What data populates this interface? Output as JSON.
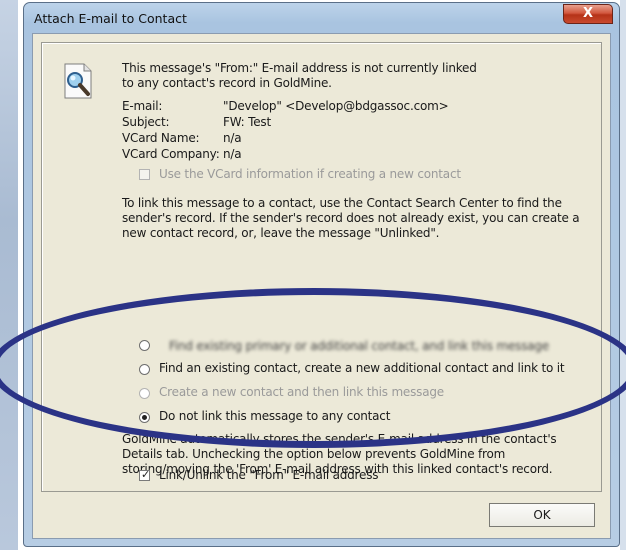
{
  "window": {
    "title": "Attach E-mail to Contact",
    "close_label": "X"
  },
  "message": "This message's \"From:\" E-mail address is not currently linked to any contact's record in GoldMine.",
  "fields": [
    {
      "label": "E-mail:",
      "value": "\"Develop\" <Develop@bdgassoc.com>"
    },
    {
      "label": "Subject:",
      "value": "FW: Test"
    },
    {
      "label": "VCard Name:",
      "value": "n/a"
    },
    {
      "label": "VCard Company:",
      "value": "n/a"
    }
  ],
  "vcard_checkbox": {
    "label": "Use the VCard information if creating a new contact",
    "checked": false,
    "enabled": false
  },
  "instructions": "To link this message to a contact, use the Contact Search Center to find the sender's record. If the sender's record does not already exist, you can create a new contact record, or, leave the message \"Unlinked\".",
  "options": [
    {
      "label": "Find existing primary or additional contact, and link this message",
      "selected": false,
      "enabled": true,
      "obscured": true
    },
    {
      "label": "Find an existing contact, create a new additional contact and link to it",
      "selected": false,
      "enabled": true
    },
    {
      "label": "Create a new contact and then link this message",
      "selected": false,
      "enabled": false
    },
    {
      "label": "Do not link this message to any contact",
      "selected": true,
      "enabled": true
    }
  ],
  "note": "GoldMine automatically stores the sender's E-mail address in the contact's Details tab. Unchecking the option below prevents GoldMine from storing/moving the 'From' E-mail address with this linked contact's record.",
  "link_checkbox": {
    "label": "Link/Unlink the \"From\" E-mail address",
    "checked": true
  },
  "ok_button": "OK",
  "colors": {
    "highlight_ellipse": "#2b3386",
    "dialog_bg": "#ece9d8"
  }
}
